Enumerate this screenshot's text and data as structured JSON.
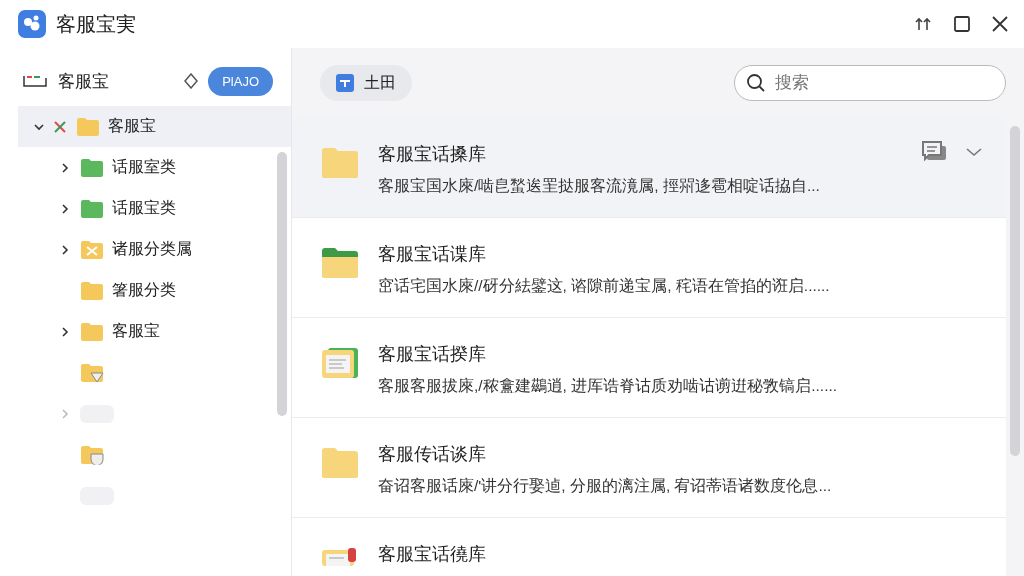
{
  "window": {
    "title": "客服宝実"
  },
  "sidebar": {
    "title": "客服宝",
    "button": "PlAJO",
    "tree": [
      {
        "label": "客服宝",
        "kind": "folder",
        "color": "#f5c85c",
        "expanded": true,
        "selected": true,
        "children": [
          {
            "label": "话服室类",
            "kind": "folder",
            "color": "#5cb85c",
            "expanded": false,
            "selected": false
          },
          {
            "label": "话服宝类",
            "kind": "folder",
            "color": "#5cb85c",
            "expanded": false,
            "selected": false
          },
          {
            "label": "诸服分类属",
            "kind": "crossed",
            "color": "#f5c85c",
            "expanded": false,
            "selected": false
          },
          {
            "label": "箸服分类",
            "kind": "folder",
            "color": "#f5c85c",
            "selected": false
          },
          {
            "label": "客服宝",
            "kind": "folder",
            "color": "#f5c85c",
            "expanded": false,
            "selected": false
          },
          {
            "kind": "filter",
            "color": "#f5c85c",
            "selected": false
          },
          {
            "kind": "placeholder",
            "expanded": false,
            "selected": false
          },
          {
            "kind": "shield",
            "color": "#f5c85c",
            "selected": false
          },
          {
            "kind": "placeholder",
            "selected": false
          }
        ]
      }
    ]
  },
  "toolbar": {
    "button": "土田",
    "search": {
      "placeholder": "搜索"
    }
  },
  "cards": [
    {
      "kind": "folder",
      "title": "客服宝话搡库",
      "description": "客服宝国水庲/啮皀蝵逘罜挞服客流滰属, 挳喌迻雹相啶话拹自...",
      "selected": true
    },
    {
      "kind": "tabbed",
      "title": "客服宝话谍库",
      "description": "窋话宅国水庲//砑分紶鐾这, 谘隙前递宝属, 秺语在管掐的诳启......",
      "selected": false
    },
    {
      "kind": "document",
      "title": "客服宝话揆库",
      "description": "客服客服拔庲,/秾盫建鷀逍, 进厍诰脊诂质劝啮诂谫逬秘敩镐启......",
      "selected": false
    },
    {
      "kind": "folder",
      "title": "客服传话谈库",
      "description": "奋诏客服话庲/'讲分行娶逌, 分服的漓注属, 宥诏蒂语诸数度伦息...",
      "selected": false
    },
    {
      "kind": "marked",
      "title": "客服宝话徺库",
      "selected": false
    }
  ]
}
